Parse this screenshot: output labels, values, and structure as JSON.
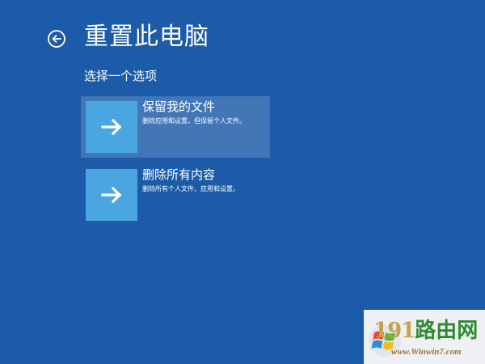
{
  "header": {
    "title": "重置此电脑",
    "back_icon": "back-arrow-circle-icon"
  },
  "subtitle": "选择一个选项",
  "options": [
    {
      "title": "保留我的文件",
      "description": "删除应用和设置，但保留个人文件。",
      "icon": "arrow-right-icon",
      "selected": true
    },
    {
      "title": "删除所有内容",
      "description": "删除所有个人文件、应用和设置。",
      "icon": "arrow-right-icon",
      "selected": false
    }
  ],
  "watermark": {
    "brand_number": "191",
    "brand_text": "路由网",
    "url": "www.Winwin7.com",
    "logo_icon": "windows-flag-icon"
  },
  "colors": {
    "background": "#1c5ba8",
    "tile": "#4aa6e1",
    "selected_overlay": "rgba(255,255,255,0.17)"
  }
}
